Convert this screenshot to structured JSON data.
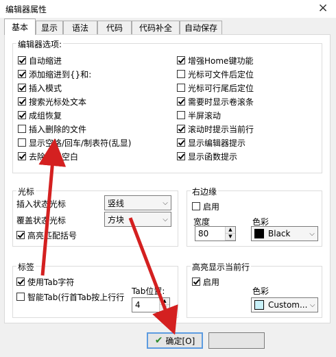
{
  "window": {
    "title": "编辑器属性",
    "close_glyph": "×"
  },
  "tabs": [
    {
      "label": "基本",
      "active": true
    },
    {
      "label": "显示"
    },
    {
      "label": "语法"
    },
    {
      "label": "代码"
    },
    {
      "label": "代码补全"
    },
    {
      "label": "自动保存"
    }
  ],
  "editor_options": {
    "title": "编辑器选项:",
    "left": [
      {
        "label": "自动缩进",
        "checked": true
      },
      {
        "label": "添加缩进到{}和:",
        "checked": true
      },
      {
        "label": "插入模式",
        "checked": true
      },
      {
        "label": "搜索光标处文本",
        "checked": true
      },
      {
        "label": "成组恢复",
        "checked": true
      },
      {
        "label": "插入删除的文件",
        "checked": false
      },
      {
        "label": "显示空格/回车/制表符(乱显)",
        "checked": false
      },
      {
        "label": "去除行尾空白",
        "checked": true
      }
    ],
    "right": [
      {
        "label": "增强Home键功能",
        "checked": true
      },
      {
        "label": "光标可文件后定位",
        "checked": false
      },
      {
        "label": "光标可行尾后定位",
        "checked": false
      },
      {
        "label": "需要时显示卷滚条",
        "checked": true
      },
      {
        "label": "半屏滚动",
        "checked": false
      },
      {
        "label": "滚动时提示当前行",
        "checked": true
      },
      {
        "label": "显示编辑器提示",
        "checked": true
      },
      {
        "label": "显示函数提示",
        "checked": true
      }
    ]
  },
  "cursor": {
    "title": "光标",
    "insert_label": "插入状态光标",
    "insert_value": "竖线",
    "overwrite_label": "覆盖状态光标",
    "overwrite_value": "方块",
    "highlight_label": "高亮匹配括号",
    "highlight_checked": true
  },
  "right_margin": {
    "title": "右边缘",
    "enable_label": "启用",
    "enable_checked": false,
    "width_label": "宽度",
    "width_value": "80",
    "color_label": "色彩",
    "color_value": "Black",
    "color_hex": "#000000"
  },
  "tab_settings": {
    "title": "标签",
    "use_tab_label": "使用Tab字符",
    "use_tab_checked": true,
    "smart_tab_label": "智能Tab(行首Tab按上行行",
    "smart_tab_checked": false,
    "tab_pos_label": "Tab位置:",
    "tab_pos_value": "4"
  },
  "highlight_line": {
    "title": "高亮显示当前行",
    "enable_label": "启用",
    "enable_checked": true,
    "color_label": "色彩",
    "color_value": "Custom...",
    "color_hex": "#c8f0f8"
  },
  "buttons": {
    "ok": "确定[O]",
    "ok_icon": "✔"
  },
  "colors": {
    "checkmark": "#2e8b2e",
    "arrow_red": "#d42020"
  }
}
